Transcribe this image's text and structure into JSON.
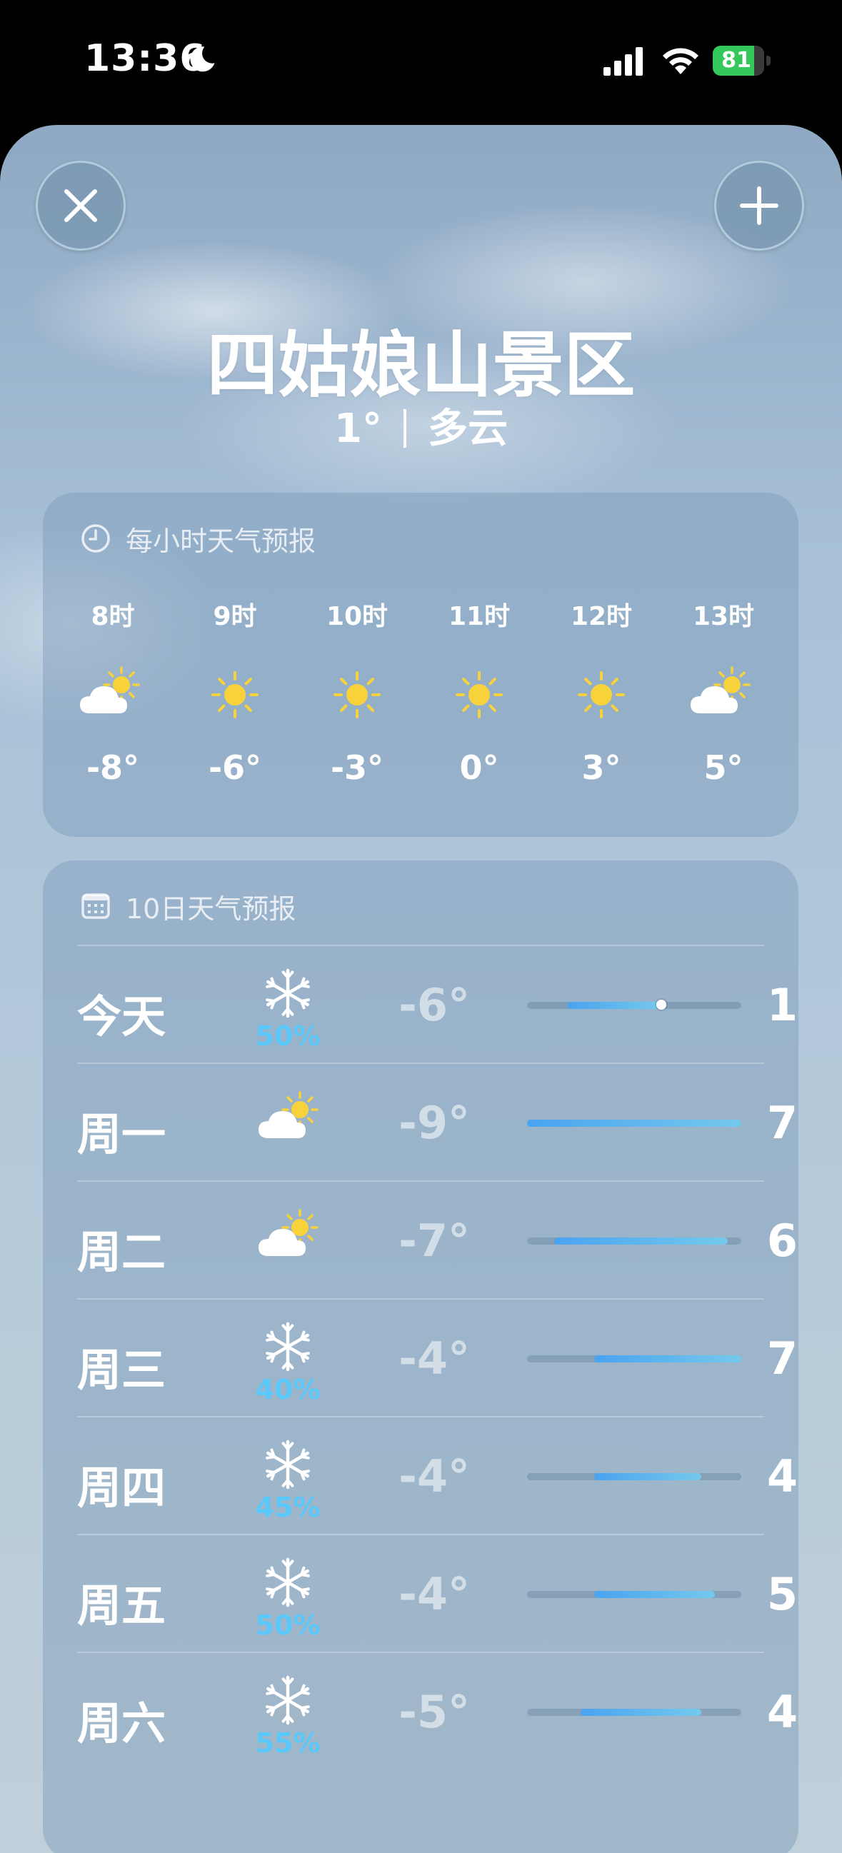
{
  "status_bar": {
    "time": "13:36",
    "battery": "81",
    "battery_level": 0.81
  },
  "header": {
    "location": "四姑娘山景区",
    "current_temp": "1°",
    "condition": "多云"
  },
  "hourly": {
    "title": "每小时天气预报",
    "items": [
      {
        "time": "8时",
        "icon": "sun-cloud-icon",
        "temp": "-8°"
      },
      {
        "time": "9时",
        "icon": "sun-icon",
        "temp": "-6°"
      },
      {
        "time": "10时",
        "icon": "sun-icon",
        "temp": "-3°"
      },
      {
        "time": "11时",
        "icon": "sun-icon",
        "temp": "0°"
      },
      {
        "time": "12时",
        "icon": "sun-icon",
        "temp": "3°"
      },
      {
        "time": "13时",
        "icon": "sun-cloud-icon",
        "temp": "5°"
      }
    ]
  },
  "daily": {
    "title": "10日天气预报",
    "range_min": -9,
    "range_max": 7,
    "current_temp_value": 1,
    "items": [
      {
        "day": "今天",
        "icon": "snowflake-icon",
        "pct": "50%",
        "low": "-6°",
        "high": "1°",
        "low_value": -6,
        "high_value": 1
      },
      {
        "day": "周一",
        "icon": "sun-cloud-icon",
        "pct": "",
        "low": "-9°",
        "high": "7°",
        "low_value": -9,
        "high_value": 7
      },
      {
        "day": "周二",
        "icon": "sun-cloud-icon",
        "pct": "",
        "low": "-7°",
        "high": "6°",
        "low_value": -7,
        "high_value": 6
      },
      {
        "day": "周三",
        "icon": "snowflake-icon",
        "pct": "40%",
        "low": "-4°",
        "high": "7°",
        "low_value": -4,
        "high_value": 7
      },
      {
        "day": "周四",
        "icon": "snowflake-icon",
        "pct": "45%",
        "low": "-4°",
        "high": "4°",
        "low_value": -4,
        "high_value": 4
      },
      {
        "day": "周五",
        "icon": "snowflake-icon",
        "pct": "50%",
        "low": "-4°",
        "high": "5°",
        "low_value": -4,
        "high_value": 5
      },
      {
        "day": "周六",
        "icon": "snowflake-icon",
        "pct": "55%",
        "low": "-5°",
        "high": "4°",
        "low_value": -5,
        "high_value": 4
      }
    ]
  },
  "colors": {
    "precip": "#5ac8fa",
    "sun": "#f7d23b",
    "bar_start": "#4aa3f0",
    "bar_end": "#74c9ec"
  }
}
